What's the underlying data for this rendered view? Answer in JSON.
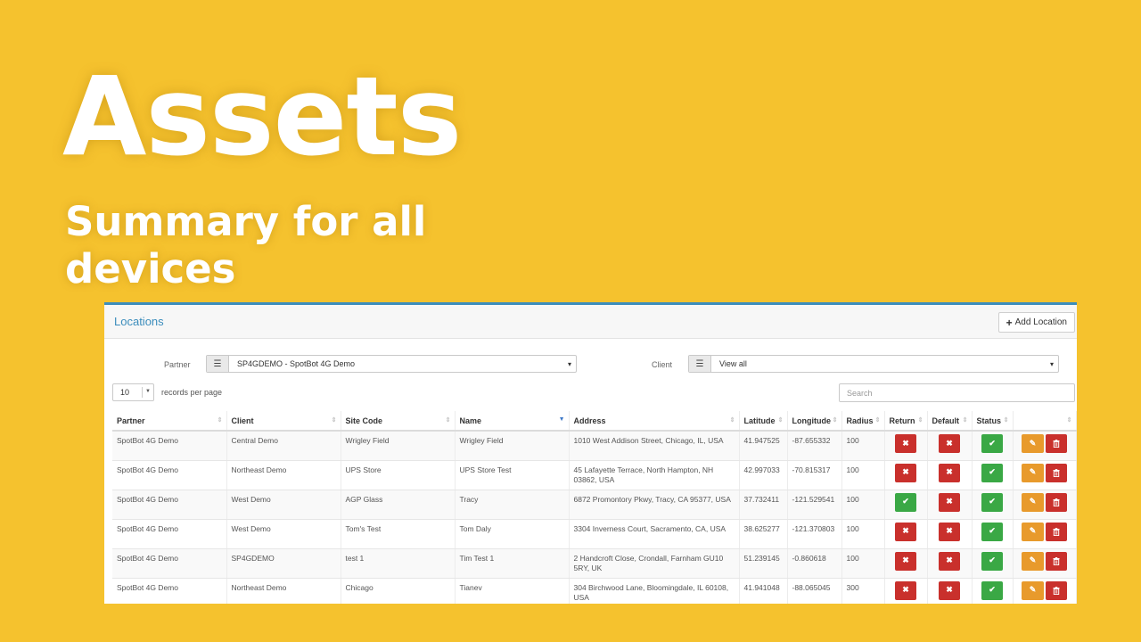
{
  "hero": {
    "title": "Assets",
    "subtitle": "Summary for all devices"
  },
  "panel": {
    "title": "Locations",
    "add_label": "Add Location"
  },
  "filters": {
    "partner_label": "Partner",
    "partner_value": "SP4GDEMO - SpotBot 4G Demo",
    "client_label": "Client",
    "client_value": "View all"
  },
  "paging": {
    "length_value": "10",
    "length_label": "records per page",
    "search_placeholder": "Search"
  },
  "columns": [
    "Partner",
    "Client",
    "Site Code",
    "Name",
    "Address",
    "Latitude",
    "Longitude",
    "Radius",
    "Return",
    "Default",
    "Status",
    ""
  ],
  "sorted_column": "Name",
  "rows": [
    {
      "partner": "SpotBot 4G Demo",
      "client": "Central Demo",
      "site_code": "Wrigley Field",
      "name": "Wrigley Field",
      "address": "1010 West Addison Street, Chicago, IL, USA",
      "latitude": "41.947525",
      "longitude": "-87.655332",
      "radius": "100",
      "return": false,
      "default": false,
      "status": true
    },
    {
      "partner": "SpotBot 4G Demo",
      "client": "Northeast Demo",
      "site_code": "UPS Store",
      "name": "UPS Store Test",
      "address": "45 Lafayette Terrace, North Hampton, NH 03862, USA",
      "latitude": "42.997033",
      "longitude": "-70.815317",
      "radius": "100",
      "return": false,
      "default": false,
      "status": true
    },
    {
      "partner": "SpotBot 4G Demo",
      "client": "West Demo",
      "site_code": "AGP Glass",
      "name": "Tracy",
      "address": "6872 Promontory Pkwy, Tracy, CA 95377, USA",
      "latitude": "37.732411",
      "longitude": "-121.529541",
      "radius": "100",
      "return": true,
      "default": false,
      "status": true
    },
    {
      "partner": "SpotBot 4G Demo",
      "client": "West Demo",
      "site_code": "Tom's Test",
      "name": "Tom Daly",
      "address": "3304 Inverness Court, Sacramento, CA, USA",
      "latitude": "38.625277",
      "longitude": "-121.370803",
      "radius": "100",
      "return": false,
      "default": false,
      "status": true
    },
    {
      "partner": "SpotBot 4G Demo",
      "client": "SP4GDEMO",
      "site_code": "test 1",
      "name": "Tim Test 1",
      "address": "2 Handcroft Close, Crondall, Farnham GU10 5RY, UK",
      "latitude": "51.239145",
      "longitude": "-0.860618",
      "radius": "100",
      "return": false,
      "default": false,
      "status": true
    },
    {
      "partner": "SpotBot 4G Demo",
      "client": "Northeast Demo",
      "site_code": "Chicago",
      "name": "Tianev",
      "address": "304 Birchwood Lane, Bloomingdale, IL 60108, USA",
      "latitude": "41.941048",
      "longitude": "-88.065045",
      "radius": "300",
      "return": false,
      "default": false,
      "status": true
    }
  ],
  "icons": {
    "check": "check-icon",
    "cross": "close-icon",
    "edit": "edit-icon",
    "delete": "trash-icon",
    "list": "list-icon",
    "plus": "plus-icon"
  },
  "colors": {
    "background": "#f5c22e",
    "accent": "#3c8dbc",
    "danger": "#c9302c",
    "success": "#3aa845",
    "warning": "#e89a2c"
  }
}
